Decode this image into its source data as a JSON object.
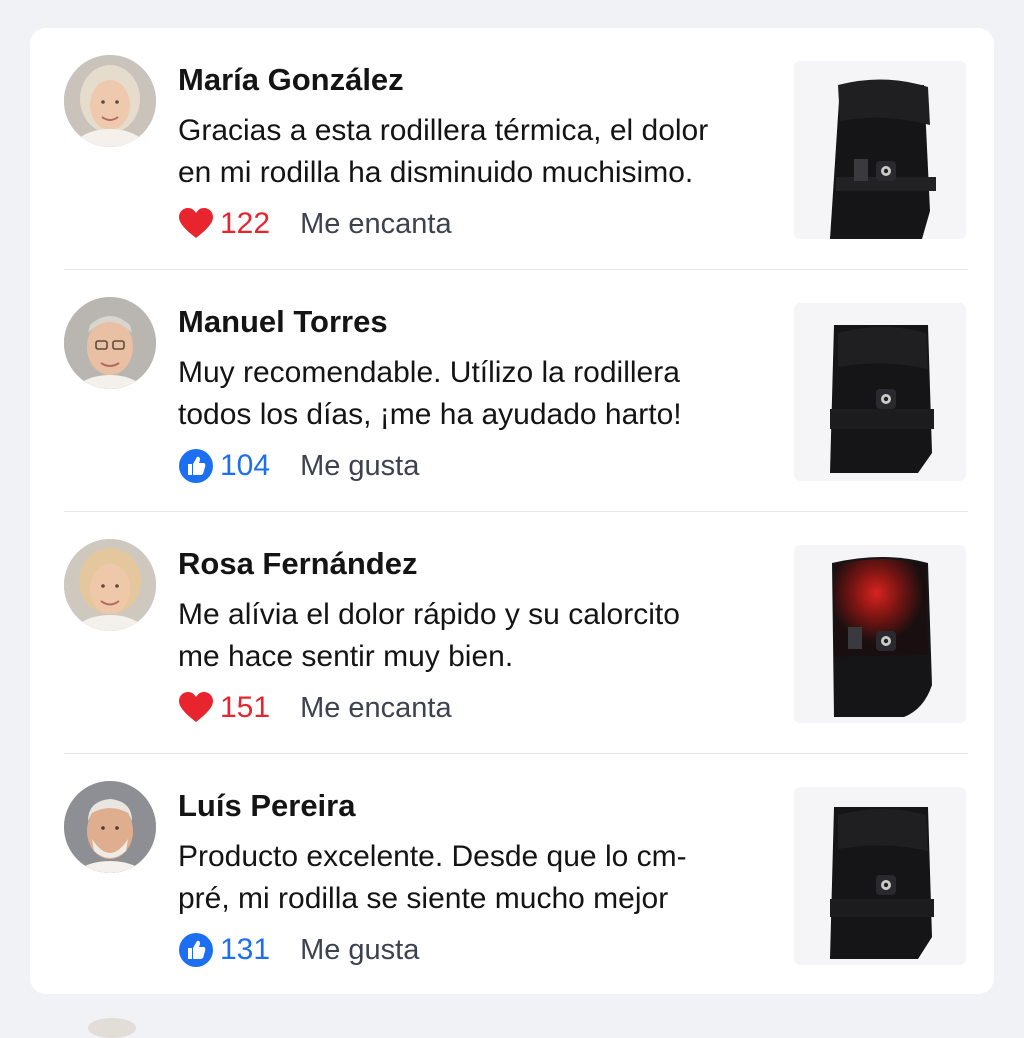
{
  "reviews": [
    {
      "name": "María González",
      "text_lines": [
        "Gracias a esta rodillera térmica, el dolor",
        "en mi rodilla ha disminuido muchisimo."
      ],
      "reaction_icon": "heart-icon",
      "count": "122",
      "label": "Me encanta",
      "count_color": "#e8242f",
      "product_glow": false
    },
    {
      "name": "Manuel Torres",
      "text_lines": [
        "Muy recomendable. Utílizo la rodillera",
        "todos los días, ¡me ha ayudado harto!"
      ],
      "reaction_icon": "thumbs-up-icon",
      "count": "104",
      "label": "Me gusta",
      "count_color": "#1b6ff0",
      "product_glow": false
    },
    {
      "name": "Rosa Fernández",
      "text_lines": [
        "Me alívia el dolor rápido y su calorcito",
        "me hace sentir muy bien."
      ],
      "reaction_icon": "heart-icon",
      "count": "151",
      "label": "Me encanta",
      "count_color": "#e8242f",
      "product_glow": true
    },
    {
      "name": "Luís Pereira",
      "text_lines": [
        "Producto excelente. Desde que lo cm-",
        "pré, mi rodilla se siente mucho mejor"
      ],
      "reaction_icon": "thumbs-up-icon",
      "count": "131",
      "label": "Me gusta",
      "count_color": "#1b6ff0",
      "product_glow": false
    }
  ],
  "colors": {
    "heart": "#e8242f",
    "like": "#1b6ff0",
    "text": "#141414",
    "label": "#3d4250"
  }
}
